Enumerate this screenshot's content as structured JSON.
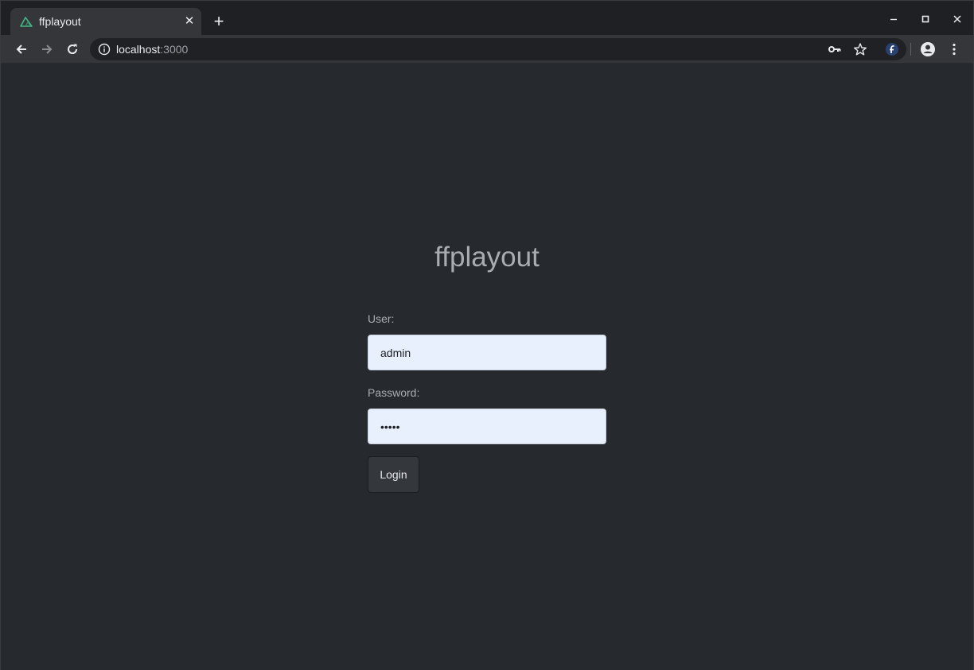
{
  "browser": {
    "tab_title": "ffplayout",
    "tab_close_icon": "close-icon",
    "new_tab_icon": "plus-icon",
    "favicon": "nuxt-logo-icon",
    "url_host": "localhost",
    "url_port": ":3000",
    "window_controls": {
      "minimize": "–",
      "maximize": "□",
      "close": "✕"
    },
    "toolbar_icons": [
      "back-arrow-icon",
      "forward-arrow-icon",
      "reload-icon",
      "info-icon",
      "key-icon",
      "star-icon",
      "fedora-extension-icon",
      "account-icon",
      "more-menu-icon"
    ]
  },
  "page": {
    "title": "ffplayout",
    "user_label": "User:",
    "user_value": "admin",
    "password_label": "Password:",
    "password_value": "admin",
    "login_button": "Login"
  },
  "colors": {
    "page_background": "#26292e",
    "input_background": "#e8f0fe",
    "favicon_accent": "#41b883"
  }
}
